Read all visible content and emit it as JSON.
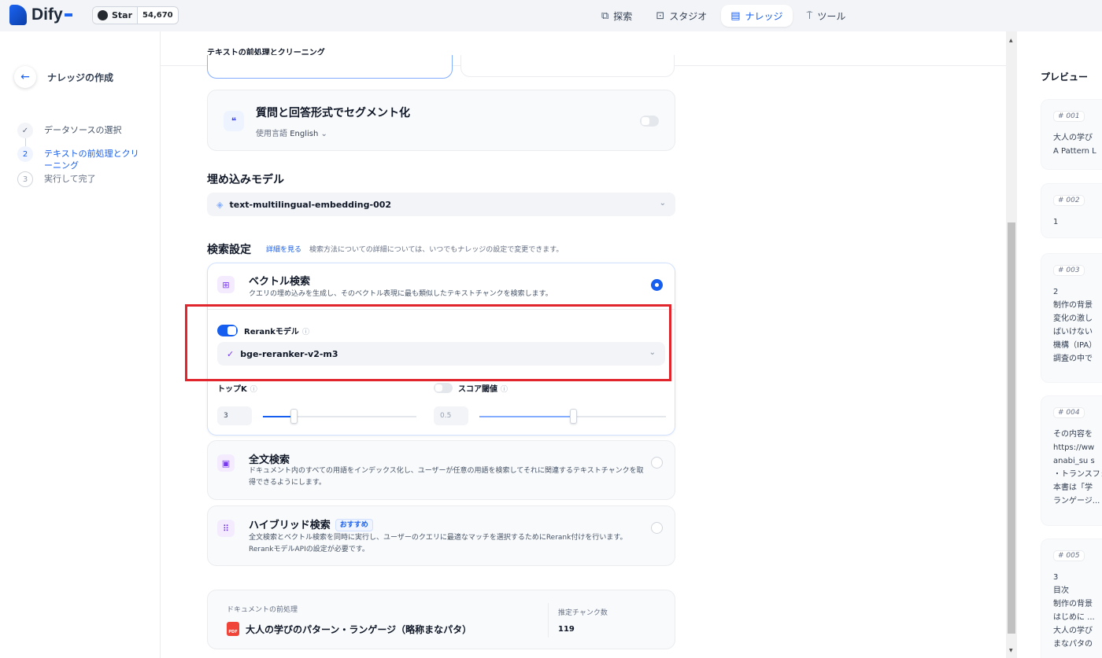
{
  "topbar": {
    "brand": "Dify",
    "github_star_label": "Star",
    "github_star_count": "54,670",
    "nav": [
      {
        "label": "探索",
        "icon": "compass-icon",
        "glyph": "⧉",
        "active": false
      },
      {
        "label": "スタジオ",
        "icon": "robot-icon",
        "glyph": "⊡",
        "active": false
      },
      {
        "label": "ナレッジ",
        "icon": "book-icon",
        "glyph": "▤",
        "active": true
      },
      {
        "label": "ツール",
        "icon": "hammer-icon",
        "glyph": "⍑",
        "active": false
      }
    ]
  },
  "sidebar": {
    "back_label": "ナレッジの作成",
    "steps": [
      {
        "marker": "✓",
        "label": "データソースの選択",
        "state": "done"
      },
      {
        "marker": "2",
        "label": "テキストの前処理とクリーニング",
        "state": "active"
      },
      {
        "marker": "3",
        "label": "実行して完了",
        "state": "todo"
      }
    ]
  },
  "main": {
    "sticky_title": "テキストの前処理とクリーニング",
    "qa": {
      "title": "質問と回答形式でセグメント化",
      "lang_prefix": "使用言語",
      "lang_value": "English",
      "enabled": false
    },
    "embedding": {
      "title": "埋め込みモデル",
      "model": "text-multilingual-embedding-002"
    },
    "retrieval": {
      "title": "検索設定",
      "learn_more": "詳細を見る",
      "description": "検索方法についての詳細については、いつでもナレッジの設定で変更できます。",
      "vector": {
        "title": "ベクトル検索",
        "description": "クエリの埋め込みを生成し、そのベクトル表現に最も類似したテキストチャンクを検索します。",
        "selected": true
      },
      "rerank": {
        "label": "Rerankモデル",
        "enabled": true,
        "model": "bge-reranker-v2-m3"
      },
      "top_k": {
        "label": "トップK",
        "value": "3",
        "fraction": 0.2
      },
      "score_threshold": {
        "label": "スコア閾値",
        "value": "0.5",
        "enabled": false,
        "fraction": 0.5
      },
      "full_text": {
        "title": "全文検索",
        "description": "ドキュメント内のすべての用語をインデックス化し、ユーザーが任意の用語を検索してそれに関連するテキストチャンクを取得できるようにします。",
        "selected": false
      },
      "hybrid": {
        "title": "ハイブリッド検索",
        "badge": "おすすめ",
        "description": "全文検索とベクトル検索を同時に実行し、ユーザーのクエリに最適なマッチを選択するためにRerank付けを行います。RerankモデルAPIの設定が必要です。",
        "selected": false
      }
    },
    "document": {
      "label": "ドキュメントの前処理",
      "name": "大人の学びのパターン・ランゲージ（略称まなパタ）",
      "chunk_label": "推定チャンク数",
      "chunk_count": "119"
    }
  },
  "preview": {
    "title": "プレビュー",
    "chunks": [
      {
        "tag": "# 001",
        "text": "大人の学び\nA Pattern L"
      },
      {
        "tag": "# 002",
        "text": "1"
      },
      {
        "tag": "# 003",
        "text": "2\n制作の背景\n変化の激し\nばいけない\n機構（IPA）\n調査の中で"
      },
      {
        "tag": "# 004",
        "text": "その内容を\nhttps://ww\nanabi_su s\n・トランスフォ\n本書は「学\nランゲージ..."
      },
      {
        "tag": "# 005",
        "text": "3\n目次\n制作の背景\nはじめに ...\n大人の学び\nまなパタの"
      }
    ]
  },
  "colors": {
    "accent": "#155eef",
    "highlight": "#e0252c"
  }
}
